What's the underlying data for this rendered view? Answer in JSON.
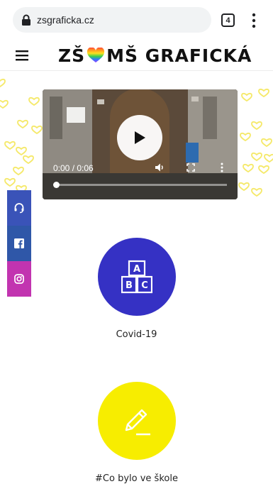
{
  "browser": {
    "url": "zsgraficka.cz",
    "tab_count": "4"
  },
  "header": {
    "logo_left": "ZŠ",
    "logo_right": "MŠ GRAFICKÁ"
  },
  "video": {
    "time": "0:00 / 0:06",
    "progress": 0.0
  },
  "social": {
    "items": [
      {
        "icon": "headset-icon",
        "color": "#3a53b8"
      },
      {
        "icon": "facebook-icon",
        "color": "#2f57a8"
      },
      {
        "icon": "instagram-icon",
        "color": "#c234b0"
      }
    ]
  },
  "features": [
    {
      "label": "Covid-19",
      "icon": "abc-blocks-icon",
      "color": "#3531c4"
    },
    {
      "label": "#Co bylo ve škole",
      "icon": "pencil-icon",
      "color": "#f7ed00"
    }
  ]
}
